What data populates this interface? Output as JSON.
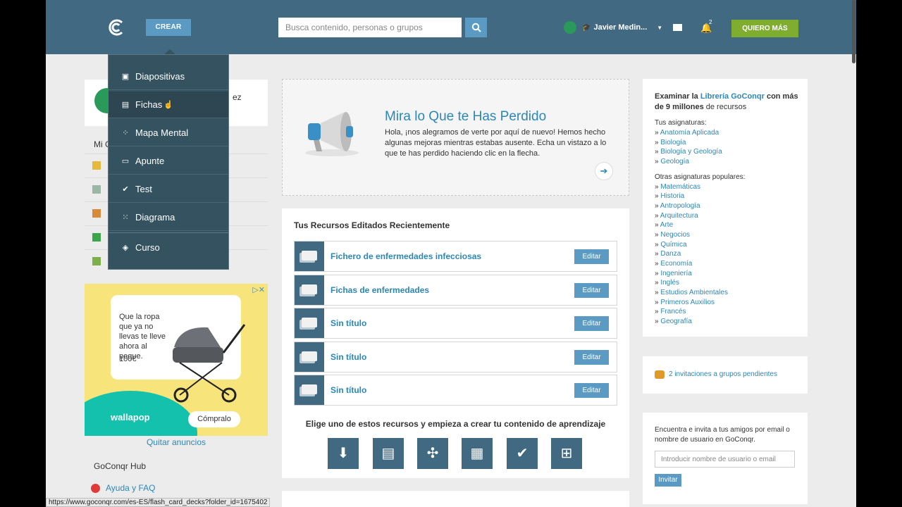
{
  "topbar": {
    "crear_label": "CREAR",
    "search_placeholder": "Busca contenido, personas o grupos",
    "user_name": "Javier Medin...",
    "notification_count": "2",
    "quiero_label": "QUIERO MÁS"
  },
  "menu": {
    "items": [
      {
        "label": "Diapositivas",
        "icon": "slides-icon"
      },
      {
        "label": "Fichas",
        "icon": "flashcards-icon"
      },
      {
        "label": "Mapa Mental",
        "icon": "mindmap-icon"
      },
      {
        "label": "Apunte",
        "icon": "note-icon"
      },
      {
        "label": "Test",
        "icon": "check-icon"
      },
      {
        "label": "Diagrama",
        "icon": "diagram-icon"
      },
      {
        "label": "Curso",
        "icon": "course-icon"
      }
    ]
  },
  "left": {
    "profile_name_fragment": "ez",
    "nav_title": "Mi C",
    "ad": {
      "text": "Que la ropa que ya no llevas te lleve ahora al peque.",
      "price": "100€",
      "brand": "wallapop",
      "button": "Cómpralo"
    },
    "quitar_anuncios": "Quitar anuncios",
    "hub_title": "GoConqr Hub",
    "ayuda": "Ayuda y FAQ"
  },
  "mira": {
    "title": "Mira lo Que te Has Perdido",
    "body": "Hola, ¡nos alegramos de verte por aquí de nuevo! Hemos hecho algunas mejoras mientras estabas ausente. Echa un vistazo a lo que te has perdido haciendo clic en la flecha."
  },
  "recent": {
    "title": "Tus Recursos Editados Recientemente",
    "edit_label": "Editar",
    "items": [
      "Fichero de enfermedades infecciosas",
      "Fichas de enfermedades",
      "Sin título",
      "Sin título",
      "Sin título"
    ],
    "create_prompt": "Elige uno de estos recursos y empieza a crear tu contenido de aprendizaje"
  },
  "library": {
    "head_prefix": "Examinar la ",
    "head_link": "Librería GoConqr",
    "head_mid": " con más de ",
    "head_bold": "9 millones",
    "head_suffix": " de recursos",
    "your_subjects_title": "Tus asignaturas:",
    "your_subjects": [
      "Anatomía Aplicada",
      "Biología",
      "Biología y Geología",
      "Geología"
    ],
    "popular_title": "Otras asignaturas populares:",
    "popular": [
      "Matemáticas",
      "Historia",
      "Antropología",
      "Arquitectura",
      "Arte",
      "Negocios",
      "Química",
      "Danza",
      "Economía",
      "Ingeniería",
      "Inglés",
      "Estudios Ambientales",
      "Primeros Auxilios",
      "Francés",
      "Geografía"
    ]
  },
  "invitations": {
    "text": "2 invitaciones a grupos pendientes"
  },
  "friends": {
    "text": "Encuentra e invita a tus amigos por email o nombre de usuario en GoConqr.",
    "placeholder": "Introducir nombre de usuario o email",
    "button": "Invitar"
  },
  "status_url": "https://www.goconqr.com/es-ES/flash_card_decks?folder_id=1675402"
}
